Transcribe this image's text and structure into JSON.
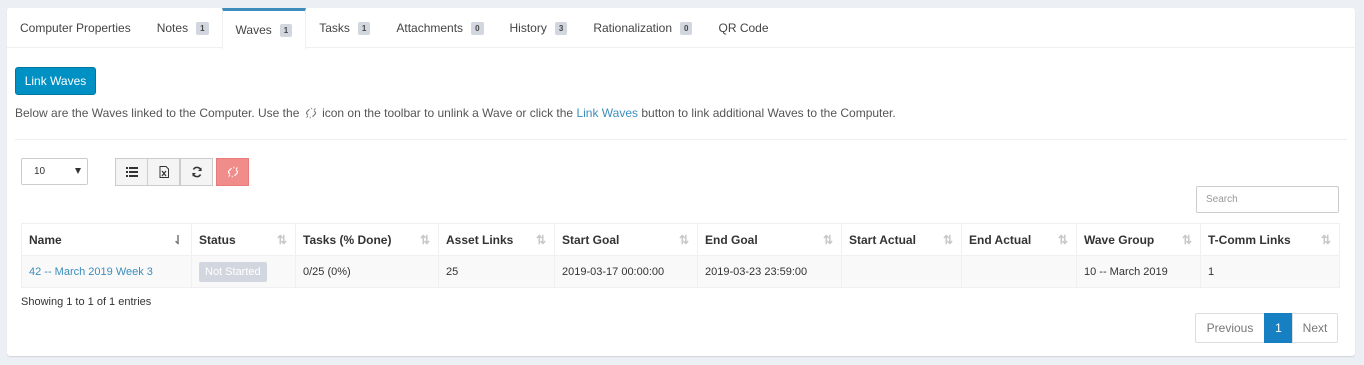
{
  "tabs": [
    {
      "label": "Computer Properties",
      "count": null
    },
    {
      "label": "Notes",
      "count": "1"
    },
    {
      "label": "Waves",
      "count": "1",
      "active": true
    },
    {
      "label": "Tasks",
      "count": "1"
    },
    {
      "label": "Attachments",
      "count": "0"
    },
    {
      "label": "History",
      "count": "3"
    },
    {
      "label": "Rationalization",
      "count": "0"
    },
    {
      "label": "QR Code",
      "count": null
    }
  ],
  "actions": {
    "link_waves_label": "Link Waves"
  },
  "help": {
    "before": "Below are the Waves linked to the Computer. Use the",
    "icon": "unlink-icon",
    "middle": "icon on the toolbar to unlink a Wave or click the",
    "link": "Link Waves",
    "after": "button to link additional Waves to the Computer."
  },
  "table_controls": {
    "page_length": "10",
    "search_placeholder": "Search",
    "toolbar_icons": [
      "list-icon",
      "excel-export-icon",
      "refresh-icon",
      "unlink-icon"
    ]
  },
  "columns": [
    "Name",
    "Status",
    "Tasks (% Done)",
    "Asset Links",
    "Start Goal",
    "End Goal",
    "Start Actual",
    "End Actual",
    "Wave Group",
    "T-Comm Links"
  ],
  "rows": [
    {
      "name": "42 -- March 2019 Week 3",
      "status": "Not Started",
      "tasks": "0/25 (0%)",
      "asset_links": "25",
      "start_goal": "2019-03-17 00:00:00",
      "end_goal": "2019-03-23 23:59:00",
      "start_actual": "",
      "end_actual": "",
      "wave_group": "10 -- March 2019",
      "tcomm_links": "1"
    }
  ],
  "info": "Showing 1 to 1 of 1 entries",
  "pagination": {
    "prev": "Previous",
    "current": "1",
    "next": "Next"
  },
  "colors": {
    "primary": "#0091c4",
    "link": "#3c8dbc",
    "active_page": "#1780c2",
    "danger_button": "#f08c8a",
    "tab_accent": "#3c8dbc"
  }
}
